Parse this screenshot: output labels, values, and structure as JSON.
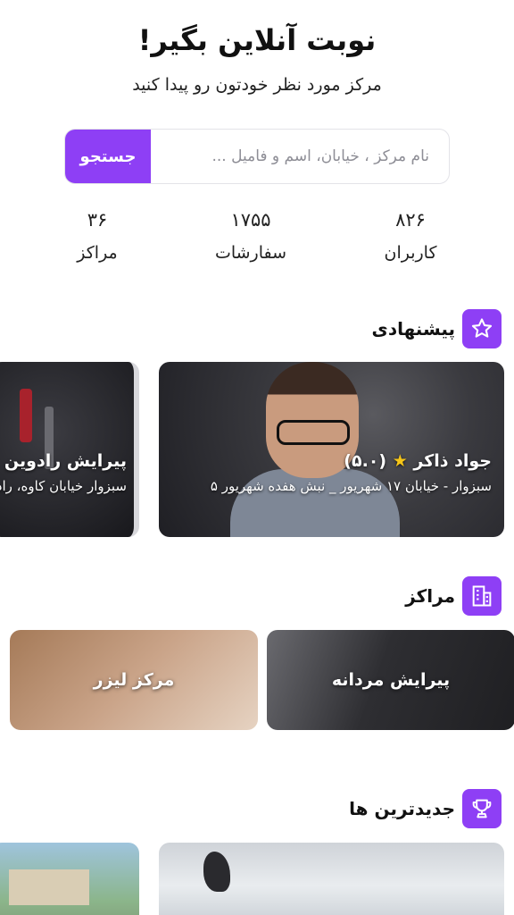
{
  "hero": {
    "title": "نوبت آنلاین بگیر!",
    "subtitle": "مرکز مورد نظر خودتون رو پیدا کنید"
  },
  "search": {
    "placeholder": "نام مرکز ، خیابان، اسم و فامیل ...",
    "value": "",
    "button_label": "جستجو"
  },
  "stats": [
    {
      "value": "۸۲۶",
      "label": "کاربران"
    },
    {
      "value": "۱۷۵۵",
      "label": "سفارشات"
    },
    {
      "value": "۳۶",
      "label": "مراکز"
    }
  ],
  "sections": {
    "suggested": {
      "title": "پیشنهادی",
      "icon": "star-icon"
    },
    "centers": {
      "title": "مراکز",
      "icon": "building-icon"
    },
    "newest": {
      "title": "جدیدترین ها",
      "icon": "trophy-icon"
    }
  },
  "featured": [
    {
      "name": "جواد ذاکر",
      "rating": "(۵.۰)",
      "address": "سبزوار - خیابان ۱۷ شهریور _ نبش هفده شهریور ۵"
    },
    {
      "name": "پیرایش رادوین",
      "address": "سبزوار خیابان کاوه، رادوین"
    }
  ],
  "categories": [
    {
      "label": "پیرایش مردانه"
    },
    {
      "label": "مرکز لیزر"
    }
  ],
  "colors": {
    "accent": "#8e3ff5",
    "star": "#f5c518"
  }
}
